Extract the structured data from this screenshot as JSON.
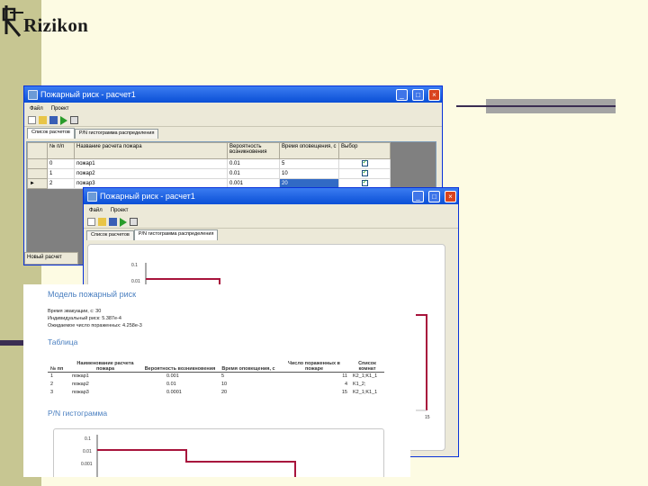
{
  "logo": {
    "text": "Rizikon"
  },
  "colors": {
    "accent_line": "#a8143c",
    "report_heading": "#4a7fc0",
    "xp_title": "#0a4fd6"
  },
  "window_back": {
    "title": "Пожарный риск - расчет1",
    "menu": [
      "Файл",
      "Проект"
    ],
    "tabs": [
      "Список расчетов",
      "P/N гистограмма распределения"
    ],
    "columns": [
      "№ п/п",
      "Название расчета пожара",
      "Вероятность возникновения",
      "Время оповещения, с",
      "Выбор"
    ],
    "rows": [
      {
        "n": "0",
        "name": "пожар1",
        "p": "0.01",
        "t": "5"
      },
      {
        "n": "1",
        "name": "пожар2",
        "p": "0.01",
        "t": "10"
      },
      {
        "n": "2",
        "name": "пожар3",
        "p": "0.001",
        "t": "20"
      }
    ],
    "row_marker": "►",
    "status": "Новый расчет"
  },
  "window_front": {
    "title": "Пожарный риск - расчет1",
    "menu": [
      "Файл",
      "Проект"
    ],
    "tabs": [
      "Список расчетов",
      "P/N гистограмма распределения"
    ],
    "y_ticks": [
      "0.1",
      "0.01"
    ],
    "x_tick": "15"
  },
  "report": {
    "title": "Модель пожарный риск",
    "lines": [
      "Время эвакуации, с: 30",
      "Индивидуальный риск: 5.387e-4",
      "Ожидаемое число пораженных: 4.258e-3"
    ],
    "table_heading": "Таблица",
    "columns": [
      "№ пп",
      "Наименование расчета пожара",
      "Вероятность возникновения",
      "Время оповещения, с",
      "Число пораженных в пожаре",
      "Список комнат"
    ],
    "rows": [
      {
        "n": "1",
        "name": "пожар1",
        "p": "0.001",
        "t": "5",
        "k": "11",
        "rooms": "K2_1;K1_1"
      },
      {
        "n": "2",
        "name": "пожар2",
        "p": "0.01",
        "t": "10",
        "k": "4",
        "rooms": "K1_2;"
      },
      {
        "n": "3",
        "name": "пожар3",
        "p": "0.0001",
        "t": "20",
        "k": "15",
        "rooms": "K2_1;K1_1"
      }
    ],
    "hist_heading": "P/N гистограмма",
    "y_ticks": [
      "0.1",
      "0.01",
      "0.001"
    ]
  }
}
